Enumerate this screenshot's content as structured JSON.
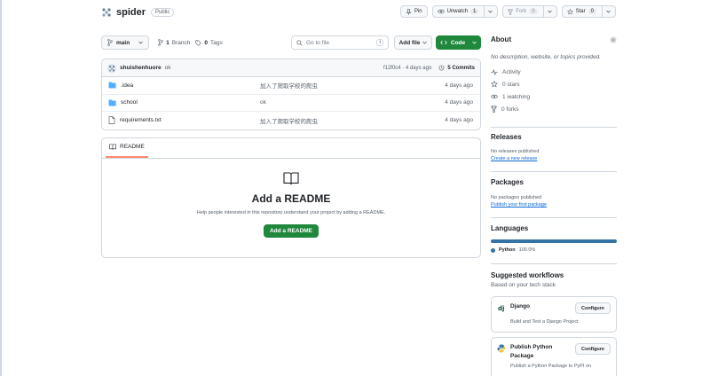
{
  "repo": {
    "name": "spider",
    "visibility": "Public",
    "pin_label": "Pin",
    "watch_label": "Unwatch",
    "watch_count": "1",
    "fork_label": "Fork",
    "fork_count": "0",
    "star_label": "Star",
    "star_count": "0"
  },
  "toolbar": {
    "branch": "main",
    "branches_count": "1",
    "branches_label": "Branch",
    "tags_count": "0",
    "tags_label": "Tags",
    "goto_placeholder": "Go to file",
    "goto_key": "t",
    "add_file": "Add file",
    "code": "Code"
  },
  "commit": {
    "author": "shuishenhuore",
    "message": "ok",
    "sha_time": "f12f0c4 · 4 days ago",
    "commits": "5 Commits"
  },
  "files": [
    {
      "name": ".idea",
      "type": "dir",
      "message": "加入了爬取学校的爬虫",
      "date": "4 days ago"
    },
    {
      "name": "school",
      "type": "dir",
      "message": "ok",
      "date": "4 days ago"
    },
    {
      "name": "requirements.txt",
      "type": "file",
      "message": "加入了爬取学校的爬虫",
      "date": "4 days ago"
    }
  ],
  "readme": {
    "tab": "README",
    "title": "Add a README",
    "desc": "Help people interested in this repository understand your project by adding a README.",
    "button": "Add a README"
  },
  "about": {
    "heading": "About",
    "description": "No description, website, or topics provided.",
    "items": [
      {
        "icon": "pulse-icon",
        "label": "Activity"
      },
      {
        "icon": "star-icon",
        "label": "0 stars"
      },
      {
        "icon": "eye-icon",
        "label": "1 watching"
      },
      {
        "icon": "fork-icon",
        "label": "0 forks"
      }
    ]
  },
  "releases": {
    "heading": "Releases",
    "sub": "No releases published",
    "link": "Create a new release"
  },
  "packages": {
    "heading": "Packages",
    "sub": "No packages published",
    "link": "Publish your first package"
  },
  "languages": {
    "heading": "Languages",
    "items": [
      {
        "name": "Python",
        "percent": "100.0%",
        "color": "#3572a5",
        "share": 1.0
      }
    ]
  },
  "workflows": {
    "heading": "Suggested workflows",
    "sub": "Based on your tech stack",
    "items": [
      {
        "name": "Django",
        "desc": "Build and Test a Django Project",
        "button": "Configure"
      },
      {
        "name_line1": "Publish Python",
        "name_line2": "Package",
        "desc": "Publish a Python Package to PyPI on",
        "button": "Configure"
      }
    ]
  },
  "colors": {
    "accent_green": "#1f883d",
    "link_blue": "#0969da",
    "folder_blue": "#54aeff",
    "tab_underline": "#fd8c73"
  }
}
